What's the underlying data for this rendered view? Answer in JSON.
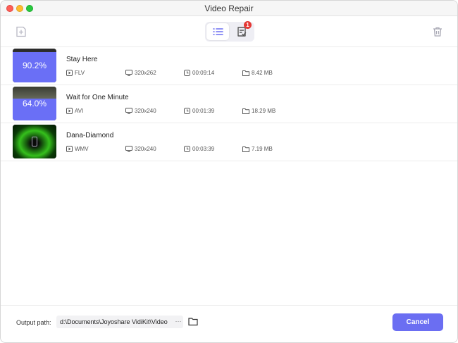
{
  "window": {
    "title": "Video Repair"
  },
  "toolbar": {
    "badge_count": "1"
  },
  "files": [
    {
      "name": "Stay Here",
      "format": "FLV",
      "resolution": "320x262",
      "duration": "00:09:14",
      "size": "8.42 MB",
      "progress": 0.902,
      "progress_label": "90.2%"
    },
    {
      "name": "Wait for One Minute",
      "format": "AVI",
      "resolution": "320x240",
      "duration": "00:01:39",
      "size": "18.29 MB",
      "progress": 0.64,
      "progress_label": "64.0%"
    },
    {
      "name": "Dana-Diamond",
      "format": "WMV",
      "resolution": "320x240",
      "duration": "00:03:39",
      "size": "7.19 MB",
      "progress": 0,
      "progress_label": ""
    }
  ],
  "footer": {
    "output_label": "Output path:",
    "output_path": "d:\\Documents\\Joyoshare VidiKit\\Video",
    "more_label": "···",
    "cancel_label": "Cancel"
  },
  "colors": {
    "accent": "#6b6ef2",
    "progress_overlay": "#6a6ff6",
    "badge": "#e53935"
  },
  "icons": [
    "add-file-icon",
    "list-view-icon",
    "task-list-icon",
    "trash-icon",
    "play-icon",
    "monitor-icon",
    "clock-icon",
    "folder-icon"
  ]
}
